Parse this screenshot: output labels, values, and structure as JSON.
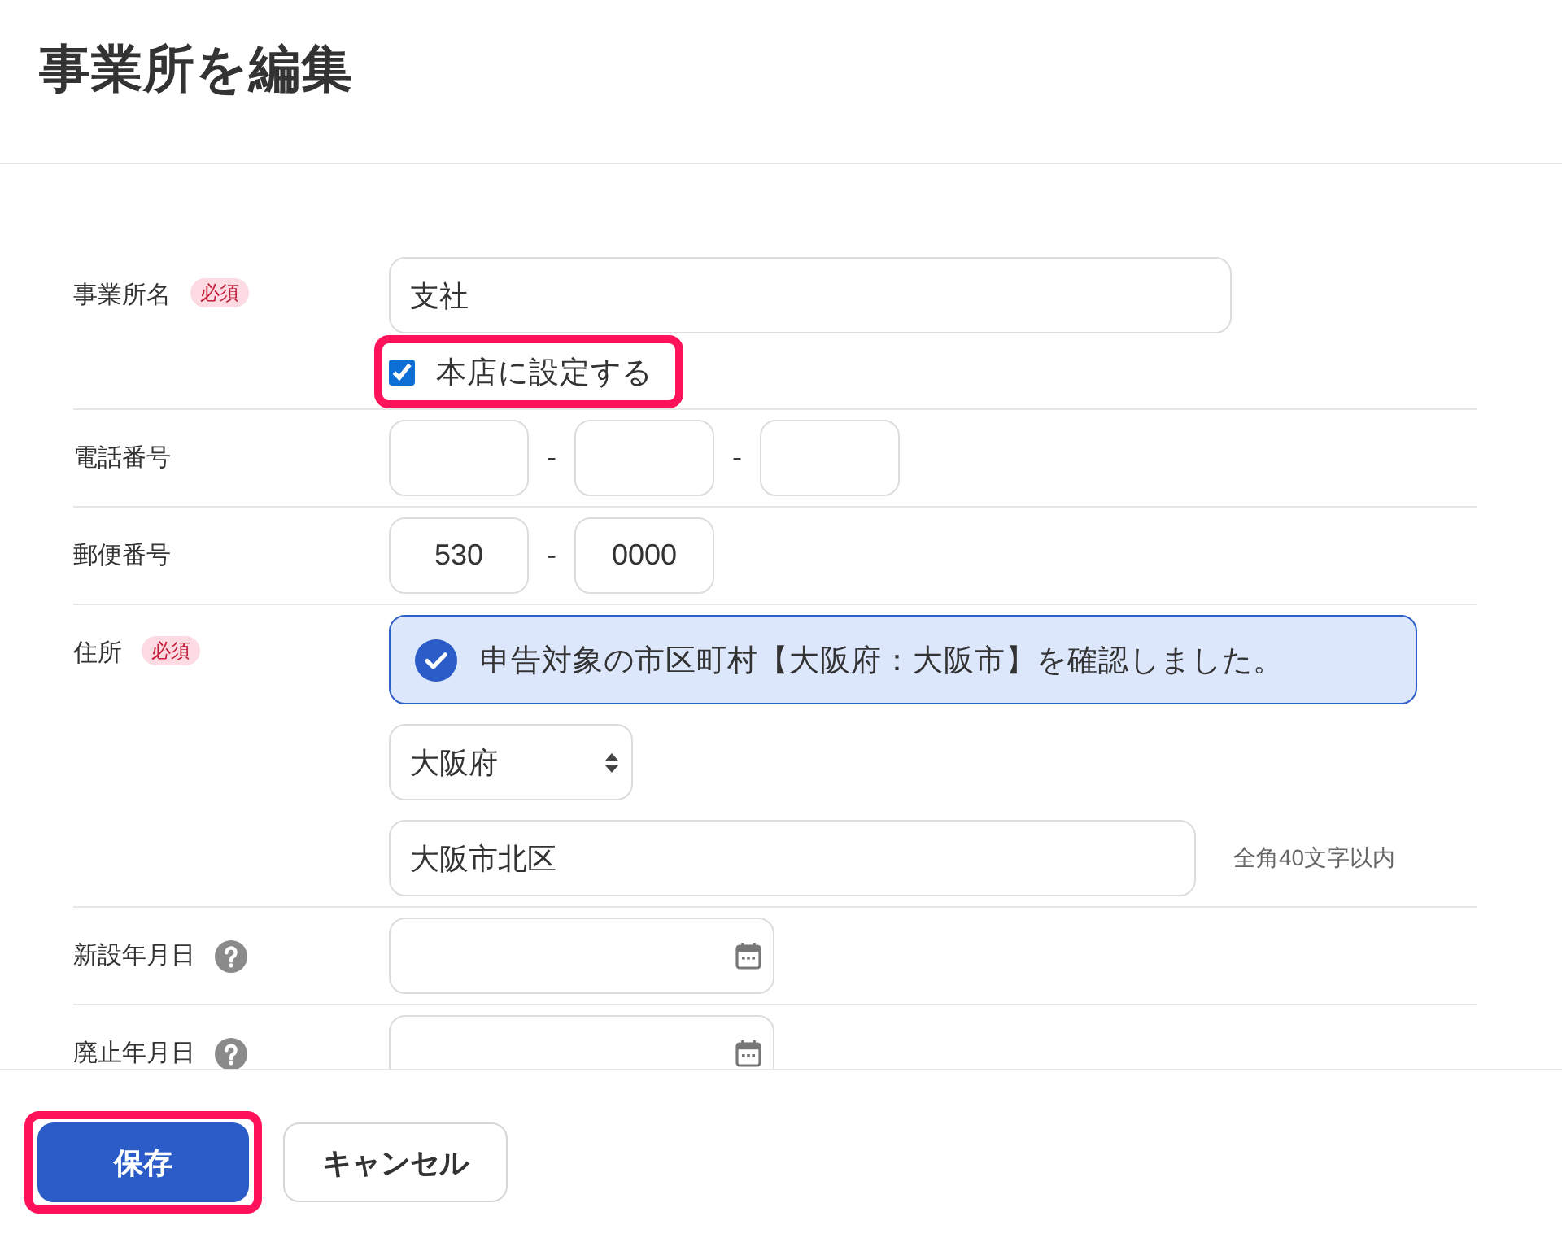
{
  "window": {
    "title": "事業所を編集"
  },
  "form": {
    "fields": [
      {
        "kind": "text",
        "label": "事業所名",
        "badge": "必須",
        "value": "支社",
        "checkbox": {
          "label": "本店に設定する",
          "checked": true,
          "highlighted": true
        }
      },
      {
        "kind": "segmented",
        "label": "電話番号",
        "segments": [
          {
            "kind": "empty"
          },
          {
            "kind": "empty",
            "separator": "-"
          },
          {
            "kind": "empty",
            "separator": "-"
          }
        ]
      },
      {
        "kind": "segmented",
        "label": "郵便番号",
        "segments": [
          {
            "kind": "filled",
            "value": "530"
          },
          {
            "kind": "filled",
            "separator": "-",
            "value": "0000"
          }
        ]
      },
      {
        "kind": "address",
        "label": "住所",
        "badge": "必須",
        "notice": {
          "text": "申告対象の市区町村【大阪府：大阪市】を確認しました。",
          "confirmed": true
        },
        "prefecture": {
          "value": "大阪府"
        },
        "city": {
          "value": "大阪市北区",
          "hint": "全角40文字以内"
        }
      },
      {
        "kind": "date",
        "label": "新設年月日",
        "help": true
      },
      {
        "kind": "date",
        "label": "廃止年月日",
        "help": true
      }
    ]
  },
  "footer": {
    "buttons": [
      {
        "kind": "primary",
        "label": "保存",
        "highlighted": true
      },
      {
        "kind": "secondary",
        "label": "キャンセル"
      }
    ]
  }
}
